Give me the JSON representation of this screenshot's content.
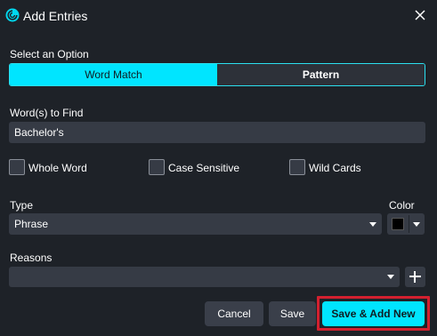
{
  "dialog": {
    "title": "Add Entries",
    "icons": {
      "app": "spiral-logo-icon",
      "close": "close-icon"
    }
  },
  "option": {
    "label": "Select an Option",
    "tabs": [
      {
        "label": "Word Match",
        "active": true
      },
      {
        "label": "Pattern",
        "active": false
      }
    ]
  },
  "words": {
    "label": "Word(s) to Find",
    "value": "Bachelor's"
  },
  "checkboxes": [
    {
      "label": "Whole Word",
      "checked": false
    },
    {
      "label": "Case Sensitive",
      "checked": false
    },
    {
      "label": "Wild Cards",
      "checked": false
    }
  ],
  "type": {
    "label": "Type",
    "value": "Phrase",
    "icon": "chevron-down-icon"
  },
  "color": {
    "label": "Color",
    "value": "#000000"
  },
  "reasons": {
    "label": "Reasons",
    "value": "",
    "add_icon": "plus-icon"
  },
  "buttons": {
    "cancel": "Cancel",
    "save": "Save",
    "save_add_new": "Save & Add New"
  },
  "colors": {
    "background": "#1e2228",
    "accent": "#00e5ff",
    "input": "#363b45",
    "highlight": "#d3202f"
  }
}
